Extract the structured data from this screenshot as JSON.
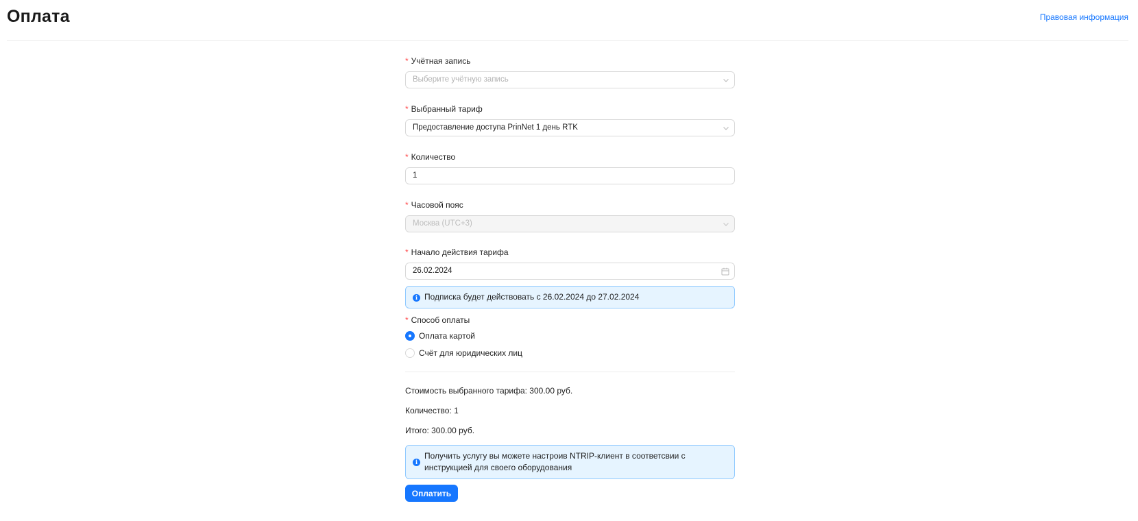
{
  "header": {
    "title": "Оплата",
    "legal_link": "Правовая информация"
  },
  "form": {
    "account": {
      "required_mark": "*",
      "label": "Учётная запись",
      "placeholder": "Выберите учётную запись"
    },
    "tariff": {
      "required_mark": "*",
      "label": "Выбранный тариф",
      "value": "Предоставление доступа PrinNet 1 день RTK"
    },
    "quantity": {
      "required_mark": "*",
      "label": "Количество",
      "value": "1"
    },
    "timezone": {
      "required_mark": "*",
      "label": "Часовой пояс",
      "value": "Москва (UTC+3)"
    },
    "start_date": {
      "required_mark": "*",
      "label": "Начало действия тарифа",
      "value": "26.02.2024"
    },
    "subscription_alert": "Подписка будет действовать с 26.02.2024 до 27.02.2024",
    "payment_method": {
      "required_mark": "*",
      "label": "Способ оплаты",
      "options": [
        {
          "label": "Оплата картой",
          "checked": true
        },
        {
          "label": "Счёт для юридических лиц",
          "checked": false
        }
      ]
    }
  },
  "summary": {
    "tariff_cost": "Стоимость выбранного тарифа: 300.00 руб.",
    "quantity": "Количество: 1",
    "total": "Итого: 300.00 руб."
  },
  "service_alert": "Получить услугу вы можете настроив NTRIP-клиент в соответсвии с инструкцией для своего оборудования",
  "pay_button": "Оплатить",
  "colors": {
    "accent": "#1677ff",
    "required": "#ff4d4f",
    "alert_bg": "#e6f4ff",
    "alert_border": "#91caff"
  }
}
